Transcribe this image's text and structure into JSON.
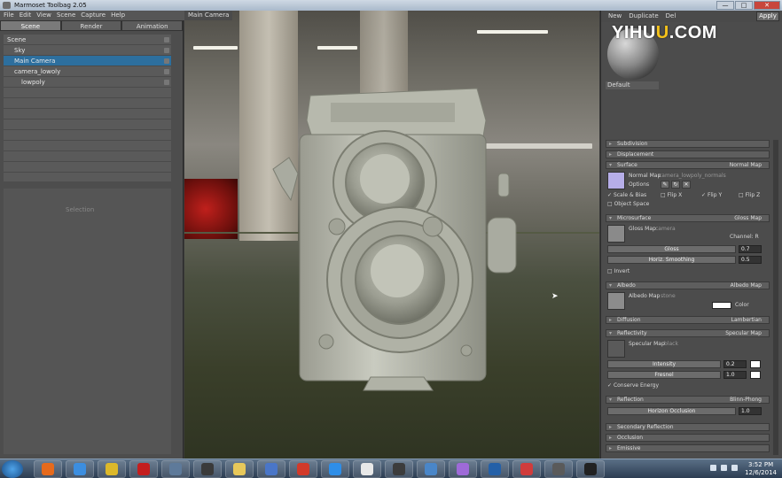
{
  "window": {
    "title": "Marmoset Toolbag 2.05",
    "controls": [
      "—",
      "□",
      "✕"
    ]
  },
  "menu": [
    "File",
    "Edit",
    "View",
    "Scene",
    "Capture",
    "Help"
  ],
  "left_panel": {
    "tabs": [
      {
        "label": "Scene"
      },
      {
        "label": "Render"
      },
      {
        "label": "Animation"
      }
    ],
    "tree": [
      {
        "label": "Scene",
        "indent": 0
      },
      {
        "label": "Sky",
        "indent": 1
      },
      {
        "label": "Main Camera",
        "indent": 1,
        "selected": true
      },
      {
        "label": "camera_lowoly",
        "indent": 1
      },
      {
        "label": "lowpoly",
        "indent": 2
      }
    ],
    "empty_rows": 8,
    "lower_placeholder": "Selection"
  },
  "viewport": {
    "tab": "Main Camera"
  },
  "right_panel": {
    "header": [
      "New",
      "Duplicate",
      "Del"
    ],
    "apply_label": "Apply",
    "material_name": "Default",
    "watermark": {
      "pre": "YIHU",
      "u": "U",
      "post": ".COM"
    },
    "sections": [
      {
        "name": "Subdivision",
        "value": ""
      },
      {
        "name": "Displacement",
        "value": ""
      },
      {
        "name": "Surface",
        "value": "Normal Map"
      },
      {
        "name": "Microsurface",
        "value": "Gloss Map"
      },
      {
        "name": "Albedo",
        "value": "Albedo Map"
      },
      {
        "name": "Diffusion",
        "value": "Lambertian"
      },
      {
        "name": "Reflectivity",
        "value": "Specular Map"
      },
      {
        "name": "Reflection",
        "value": "Blinn-Phong"
      },
      {
        "name": "Secondary Reflection",
        "value": ""
      },
      {
        "name": "Occlusion",
        "value": ""
      },
      {
        "name": "Emissive",
        "value": ""
      }
    ],
    "surface": {
      "map_label": "Normal Map",
      "map_file": "camera_lowpoly_normals",
      "options": "Options",
      "checks": [
        {
          "label": "Scale & Bias",
          "on": true
        },
        {
          "label": "Flip X",
          "on": false
        },
        {
          "label": "Flip Y",
          "on": true
        },
        {
          "label": "Flip Z",
          "on": false
        }
      ],
      "object_space": "Object Space"
    },
    "microsurface": {
      "map_label": "Gloss Map",
      "map_file": "camera",
      "channel": "Channel: R",
      "gloss_label": "Gloss",
      "gloss_value": "0.7",
      "smoothing_label": "Horiz. Smoothing",
      "smoothing_value": "0.5",
      "invert": "Invert"
    },
    "albedo": {
      "map_label": "Albedo Map",
      "map_file": "stone",
      "color": "Color"
    },
    "reflectivity": {
      "map_label": "Specular Map",
      "map_file": "black",
      "intensity_label": "Intensity",
      "intensity_value": "0.2",
      "fresnel_label": "Fresnel",
      "fresnel_value": "1.0",
      "conserve": "Conserve Energy"
    },
    "reflection": {
      "label": "Horizon Occlusion",
      "value": "1.0"
    }
  },
  "taskbar": {
    "apps": [
      "firefox-icon",
      "ie-icon",
      "chrome-icon",
      "filezilla-icon",
      "link-icon",
      "display-icon",
      "folder-icon",
      "media-icon",
      "flash-icon",
      "dropbox-icon",
      "3ds-icon",
      "marmoset-icon",
      "monitor-icon",
      "ae-icon",
      "ps-icon",
      "s-icon",
      "screen-icon",
      "camera-icon"
    ],
    "app_colors": [
      "#e66a1c",
      "#3c8ee0",
      "#dcb82a",
      "#c41e1e",
      "#5e7a9a",
      "#3a3a3a",
      "#e8c85a",
      "#4a76c8",
      "#d23a2a",
      "#2e8ee8",
      "#e8e8e8",
      "#3c3c3c",
      "#4a86c8",
      "#9e6ad8",
      "#2460a8",
      "#d03c3c",
      "#5a5a5a",
      "#222222"
    ],
    "time": "3:52 PM",
    "date": "12/6/2014"
  }
}
